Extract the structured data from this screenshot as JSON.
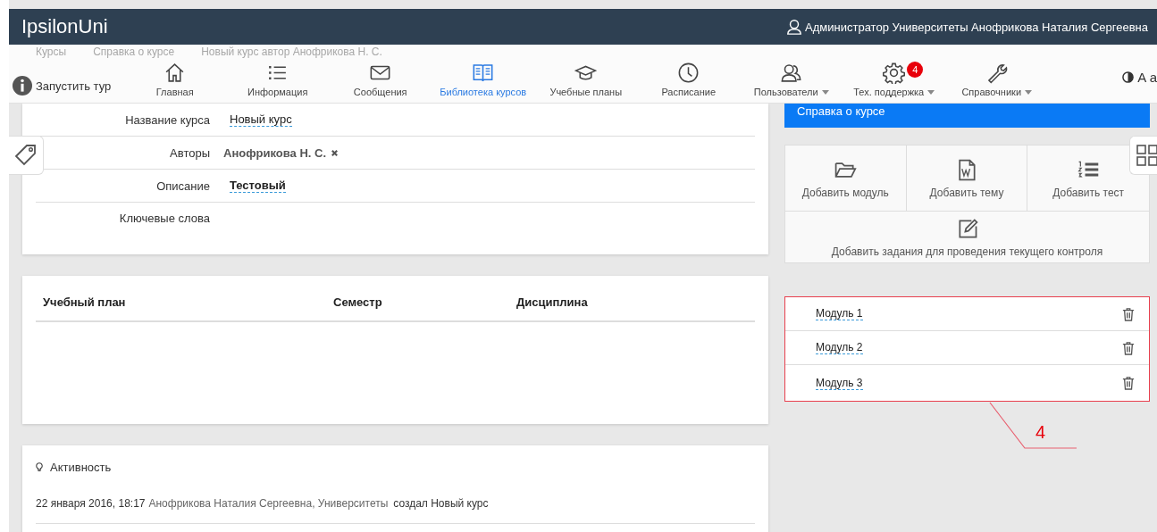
{
  "header": {
    "brand": "IpsilonUni",
    "user": "Администратор Университеты Анофрикова Наталия Сергеевна"
  },
  "breadcrumb": [
    "Курсы",
    "Справка о курсе",
    "Новый курс автор Анофрикова Н. С."
  ],
  "tour": "Запустить тур",
  "nav": [
    {
      "label": "Главная",
      "selected": false,
      "dropdown": false
    },
    {
      "label": "Информация",
      "selected": false,
      "dropdown": false
    },
    {
      "label": "Сообщения",
      "selected": false,
      "dropdown": false
    },
    {
      "label": "Библиотека курсов",
      "selected": true,
      "dropdown": false
    },
    {
      "label": "Учебные планы",
      "selected": false,
      "dropdown": false
    },
    {
      "label": "Расписание",
      "selected": false,
      "dropdown": false
    },
    {
      "label": "Пользователи",
      "selected": false,
      "dropdown": true
    },
    {
      "label": "Тех. поддержка",
      "selected": false,
      "dropdown": true,
      "badge": "4"
    },
    {
      "label": "Справочники",
      "selected": false,
      "dropdown": true
    }
  ],
  "text_size": "A a",
  "course_fields": [
    {
      "label": "Название курса",
      "value": "Новый курс",
      "kind": "editable",
      "bold": false
    },
    {
      "label": "Авторы",
      "value": "Анофрикова Н. С.",
      "kind": "tag",
      "bold": true
    },
    {
      "label": "Описание",
      "value": "Тестовый",
      "kind": "editable",
      "bold": true
    },
    {
      "label": "Ключевые слова",
      "kind": "empty"
    }
  ],
  "plan_table": {
    "columns": [
      "Учебный план",
      "Семестр",
      "Дисциплина"
    ]
  },
  "activity": {
    "title": "Активность",
    "entries": [
      {
        "time": "22 января 2016, 18:17",
        "actor": "Анофрикова Наталия Сергеевна, Университеты",
        "action": "создал Новый курс"
      }
    ]
  },
  "side": {
    "title": "Справка о курсе",
    "actions": [
      "Добавить модуль",
      "Добавить тему",
      "Добавить тест",
      "Добавить задания для проведения текущего контроля"
    ],
    "modules": [
      "Модуль 1",
      "Модуль 2",
      "Модуль 3"
    ],
    "callout": "4"
  }
}
